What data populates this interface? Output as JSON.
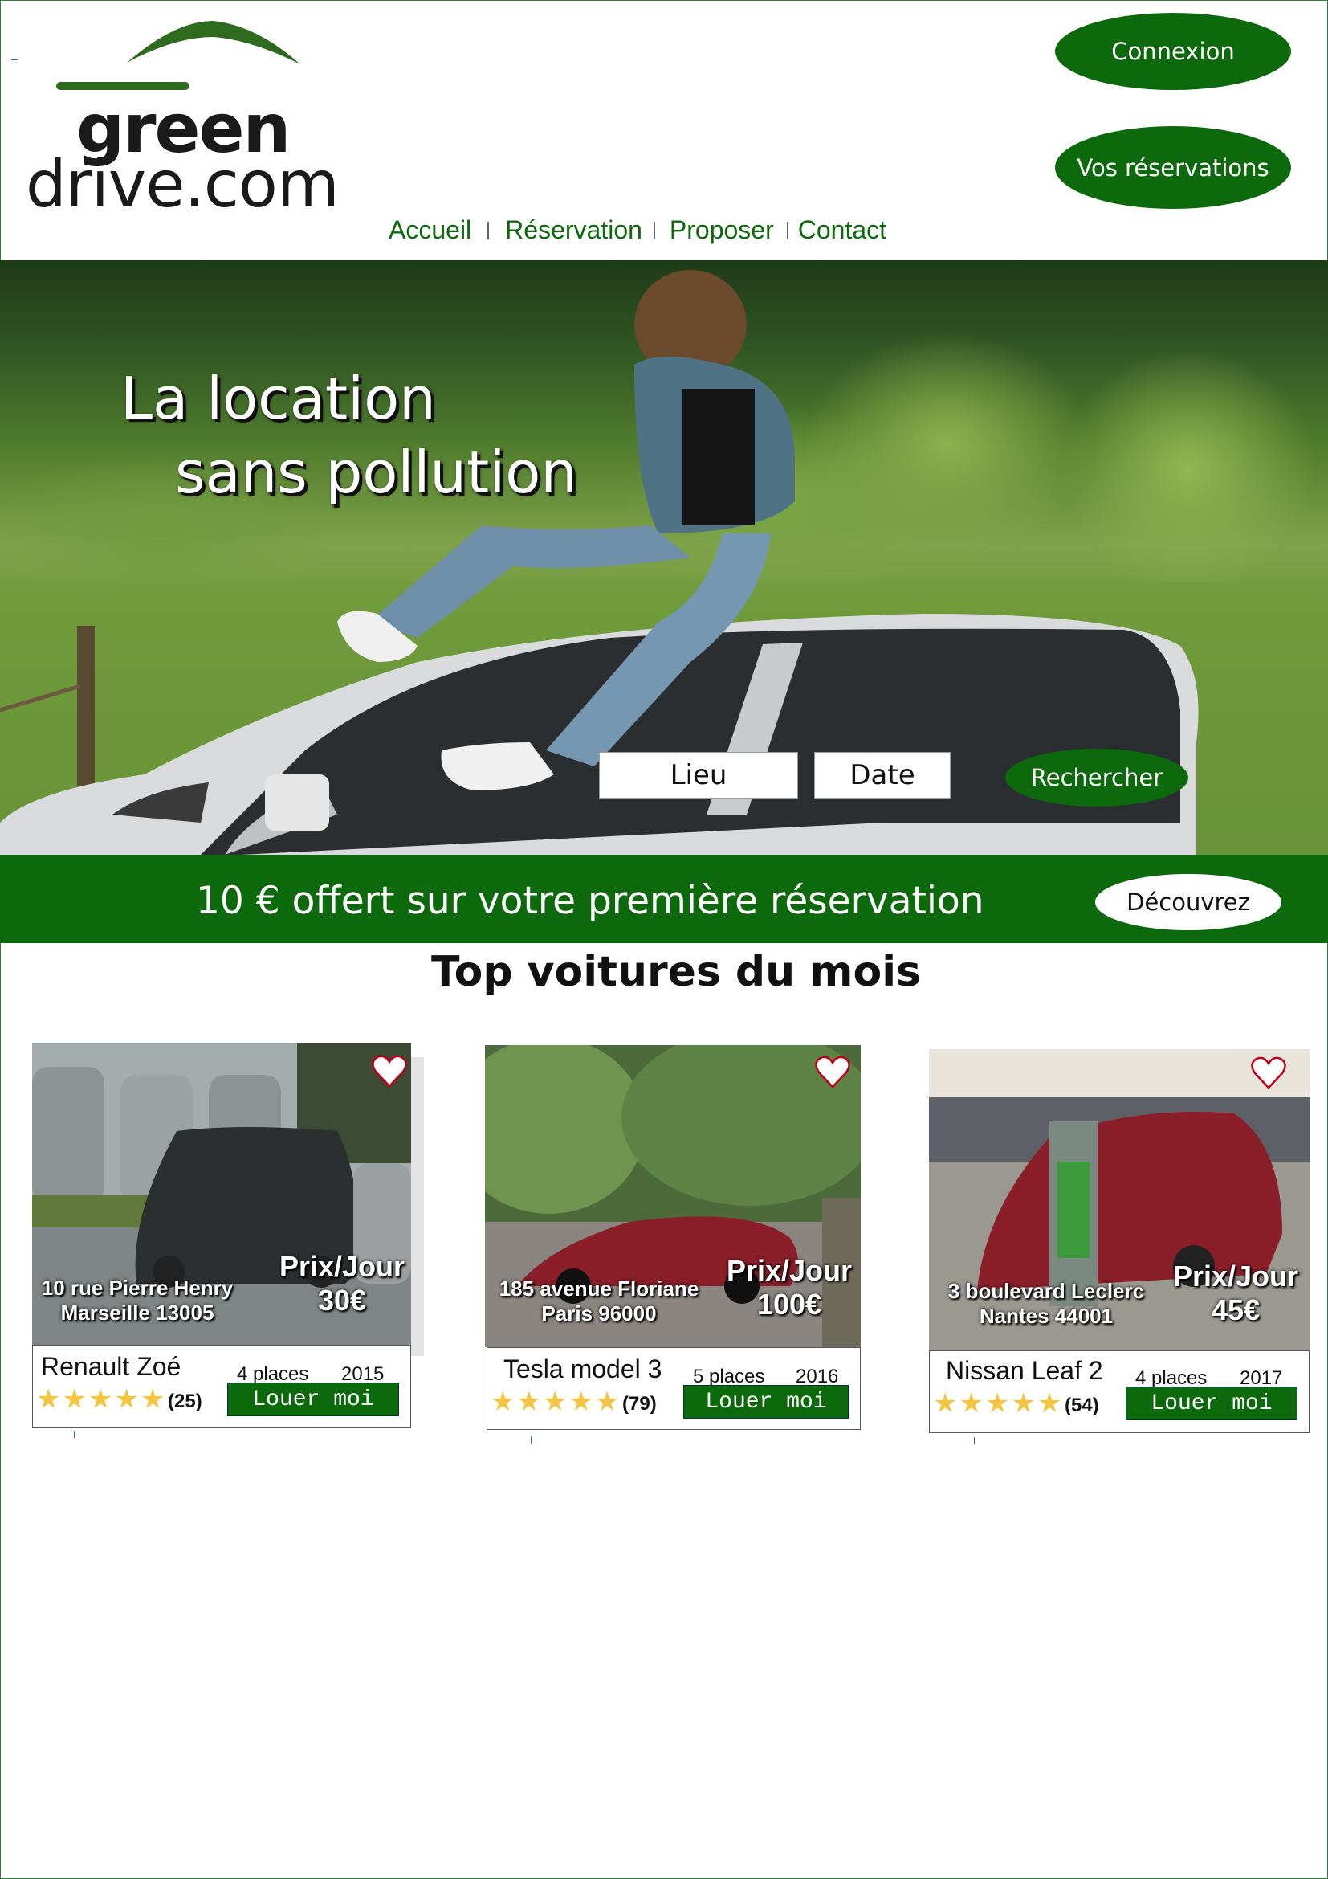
{
  "header": {
    "logo_line1": "green",
    "logo_line2": "drive.com",
    "connexion_label": "Connexion",
    "reservations_label": "Vos réservations",
    "nav": [
      "Accueil",
      "Réservation",
      "Proposer",
      "Contact"
    ]
  },
  "hero": {
    "title_line1": "La location",
    "title_line2": "sans pollution",
    "lieu_placeholder": "Lieu",
    "date_placeholder": "Date",
    "search_label": "Rechercher"
  },
  "promo": {
    "text": "10 € offert sur votre première réservation",
    "cta_label": "Découvrez"
  },
  "section_title": "Top voitures du mois",
  "cards": [
    {
      "address_line1": "10 rue Pierre Henry",
      "address_line2": "Marseille 13005",
      "price_label": "Prix/Jour",
      "price": "30€",
      "name": "Renault Zoé",
      "places": "4 places",
      "year": "2015",
      "stars": "★★★★★",
      "reviews": "(25)",
      "button_label": "Louer moi",
      "car_color": "#58b8d8"
    },
    {
      "address_line1": "185 avenue Floriane",
      "address_line2": "Paris 96000",
      "price_label": "Prix/Jour",
      "price": "100€",
      "name": "Tesla model 3",
      "places": "5 places",
      "year": "2016",
      "stars": "★★★★★",
      "reviews": "(79)",
      "button_label": "Louer moi",
      "car_color": "#2b2f30"
    },
    {
      "address_line1": "3 boulevard Leclerc",
      "address_line2": "Nantes 44001",
      "price_label": "Prix/Jour",
      "price": "45€",
      "name": "Nissan Leaf 2",
      "places": "4 places",
      "year": "2017",
      "stars": "★★★★★",
      "reviews": "(54)",
      "button_label": "Louer moi",
      "car_color": "#8a1f2a"
    }
  ],
  "colors": {
    "brand_green": "#0c6a0c",
    "star_yellow": "#f4c542",
    "heart_red": "#c0001a"
  }
}
